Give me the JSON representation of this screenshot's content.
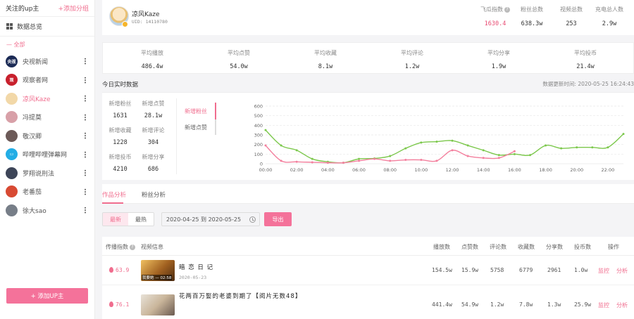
{
  "sidebar": {
    "title": "关注的up主",
    "add_group": "+添加分组",
    "overview": "数据总览",
    "group": "— 全部",
    "items": [
      {
        "name": "央视新闻",
        "color": "#1b2a55",
        "av": "央视"
      },
      {
        "name": "观察者网",
        "color": "#c8202d",
        "av": "观"
      },
      {
        "name": "凉风Kaze",
        "color": "#f2d8a8",
        "av": ""
      },
      {
        "name": "冯提莫",
        "color": "#d8a0a8",
        "av": ""
      },
      {
        "name": "敬汉卿",
        "color": "#6c5a58",
        "av": ""
      },
      {
        "name": "哔哩哔哩弹幕网",
        "color": "#23ade5",
        "av": "▭"
      },
      {
        "name": "罗翔说刑法",
        "color": "#3d4558",
        "av": ""
      },
      {
        "name": "老番茄",
        "color": "#d84a33",
        "av": ""
      },
      {
        "name": "徐大sao",
        "color": "#777e88",
        "av": ""
      }
    ],
    "add_up": "+ 添加UP主"
  },
  "profile": {
    "name": "凉风Kaze",
    "uid": "UID: 14110780",
    "stats": [
      {
        "label": "飞瓜指数",
        "value": "1630.4",
        "help": "?"
      },
      {
        "label": "粉丝总数",
        "value": "638.3w"
      },
      {
        "label": "视频总数",
        "value": "253"
      },
      {
        "label": "充电总人数",
        "value": "2.9w"
      }
    ]
  },
  "averages": [
    {
      "label": "平均播放",
      "value": "486.4w"
    },
    {
      "label": "平均点赞",
      "value": "54.0w"
    },
    {
      "label": "平均收藏",
      "value": "8.1w"
    },
    {
      "label": "平均评论",
      "value": "1.2w"
    },
    {
      "label": "平均分享",
      "value": "1.9w"
    },
    {
      "label": "平均投币",
      "value": "21.4w"
    }
  ],
  "realtime": {
    "title": "今日实时数据",
    "update_time": "数据更新时间: 2020-05-25 16:24:43",
    "stats": [
      {
        "label": "新增粉丝",
        "value": "1631"
      },
      {
        "label": "新增点赞",
        "value": "28.1w"
      },
      {
        "label": "新增收藏",
        "value": "1228"
      },
      {
        "label": "新增评论",
        "value": "304"
      },
      {
        "label": "新增投币",
        "value": "4210"
      },
      {
        "label": "新增分享",
        "value": "686"
      }
    ],
    "tabs": [
      "新增粉丝",
      "新增点赞"
    ]
  },
  "chart_data": {
    "type": "line",
    "x": [
      "00:00",
      "01:00",
      "02:00",
      "03:00",
      "04:00",
      "05:00",
      "06:00",
      "07:00",
      "08:00",
      "09:00",
      "10:00",
      "11:00",
      "12:00",
      "13:00",
      "14:00",
      "15:00",
      "16:00",
      "17:00",
      "18:00",
      "19:00",
      "20:00",
      "21:00",
      "22:00",
      "23:00"
    ],
    "x_ticks": [
      "00:00",
      "02:00",
      "04:00",
      "06:00",
      "08:00",
      "10:00",
      "12:00",
      "14:00",
      "16:00",
      "18:00",
      "20:00",
      "22:00"
    ],
    "ylim": [
      0,
      600
    ],
    "y_ticks": [
      0,
      100,
      200,
      300,
      400,
      500,
      600
    ],
    "grid": true,
    "series": [
      {
        "color": "#7cc84c",
        "values": [
          350,
          190,
          140,
          50,
          20,
          10,
          50,
          55,
          80,
          160,
          220,
          230,
          240,
          190,
          140,
          90,
          100,
          90,
          190,
          160,
          170,
          170,
          170,
          310
        ]
      },
      {
        "color": "#f3809e",
        "values": [
          190,
          30,
          20,
          15,
          10,
          10,
          30,
          50,
          30,
          40,
          40,
          30,
          140,
          80,
          60,
          60,
          130,
          null,
          null,
          null,
          null,
          null,
          null,
          null
        ]
      }
    ]
  },
  "tabs2": [
    "作品分析",
    "粉丝分析"
  ],
  "filters": {
    "seg": [
      "最新",
      "最热"
    ],
    "date_range": "2020-04-25 到 2020-05-25",
    "export": "导出"
  },
  "table": {
    "headers": [
      "传播指数",
      "视频信息",
      "播放数",
      "点赞数",
      "评论数",
      "收藏数",
      "分享数",
      "投币数",
      "操作"
    ],
    "rows": [
      {
        "hot": "63.9",
        "title": "暗 恋 日 记",
        "date": "2020-05-23",
        "thumb_text": "我要她 — 02:58",
        "play": "154.5w",
        "like": "15.9w",
        "comment": "5758",
        "fav": "6779",
        "share": "2961",
        "coin": "1.0w",
        "act1": "监控",
        "act2": "分析"
      },
      {
        "hot": "76.1",
        "title": "花两百万娶的老婆到期了【阅片无数48】",
        "date": "",
        "thumb_text": "",
        "play": "441.4w",
        "like": "54.9w",
        "comment": "1.2w",
        "fav": "7.8w",
        "share": "1.3w",
        "coin": "25.9w",
        "act1": "监控",
        "act2": "分析"
      }
    ]
  }
}
